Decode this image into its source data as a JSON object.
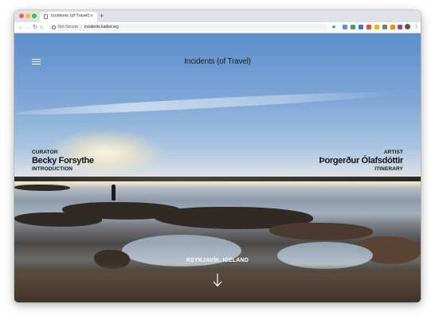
{
  "browser": {
    "tab_title": "Incidents (of Travel)",
    "tab_close": "×",
    "new_tab": "+",
    "security_label": "Not Secure",
    "url_separator": "|",
    "url": "incidents.kadist.org"
  },
  "site": {
    "title": "Incidents (of Travel)",
    "curator": {
      "role": "CURATOR",
      "name": "Becky Forsythe",
      "link": "INTRODUCTION"
    },
    "artist": {
      "role": "ARTIST",
      "name": "Þorgerður Ólafsdóttir",
      "link": "ITINERARY"
    },
    "location": "REYKJAVÍK, ICELAND"
  },
  "colors": {
    "text_dark": "#161616",
    "text_light": "#ffffff",
    "accent_blue": "#1a73e8"
  }
}
